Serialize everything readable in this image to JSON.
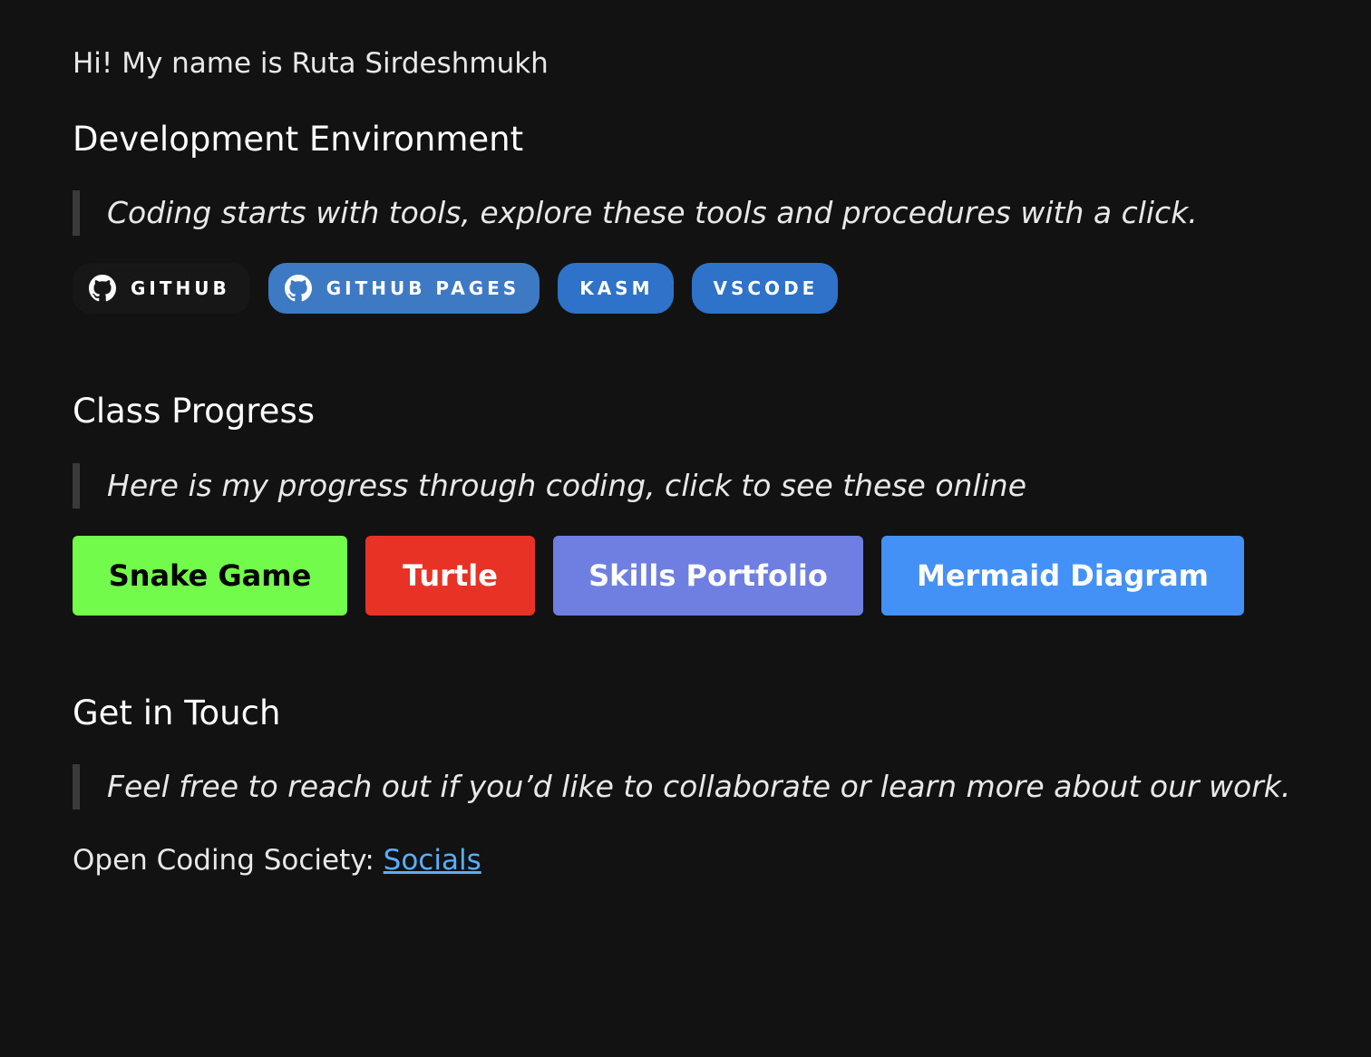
{
  "intro": {
    "text": "Hi! My name is Ruta Sirdeshmukh"
  },
  "dev_env": {
    "heading": "Development Environment",
    "quote": "Coding starts with tools, explore these tools and procedures with a click.",
    "badges": [
      {
        "label": "GITHUB",
        "icon": "github-icon",
        "color": "#171717"
      },
      {
        "label": "GITHUB PAGES",
        "icon": "github-icon",
        "color": "#3e7ac4"
      },
      {
        "label": "KASM",
        "color": "#2e72c9"
      },
      {
        "label": "VSCODE",
        "color": "#2e72c9"
      }
    ]
  },
  "progress": {
    "heading": "Class Progress",
    "quote": "Here is my progress through coding, click to see these online",
    "buttons": [
      {
        "label": "Snake Game",
        "color": "#72fb4b"
      },
      {
        "label": "Turtle",
        "color": "#e73225"
      },
      {
        "label": "Skills Portfolio",
        "color": "#6e7fe1"
      },
      {
        "label": "Mermaid Diagram",
        "color": "#4390f6"
      }
    ]
  },
  "contact": {
    "heading": "Get in Touch",
    "quote": "Feel free to reach out if you’d like to collaborate or learn more about our work.",
    "prefix": "Open Coding Society: ",
    "link_label": "Socials",
    "link_color": "#5aaeff"
  }
}
